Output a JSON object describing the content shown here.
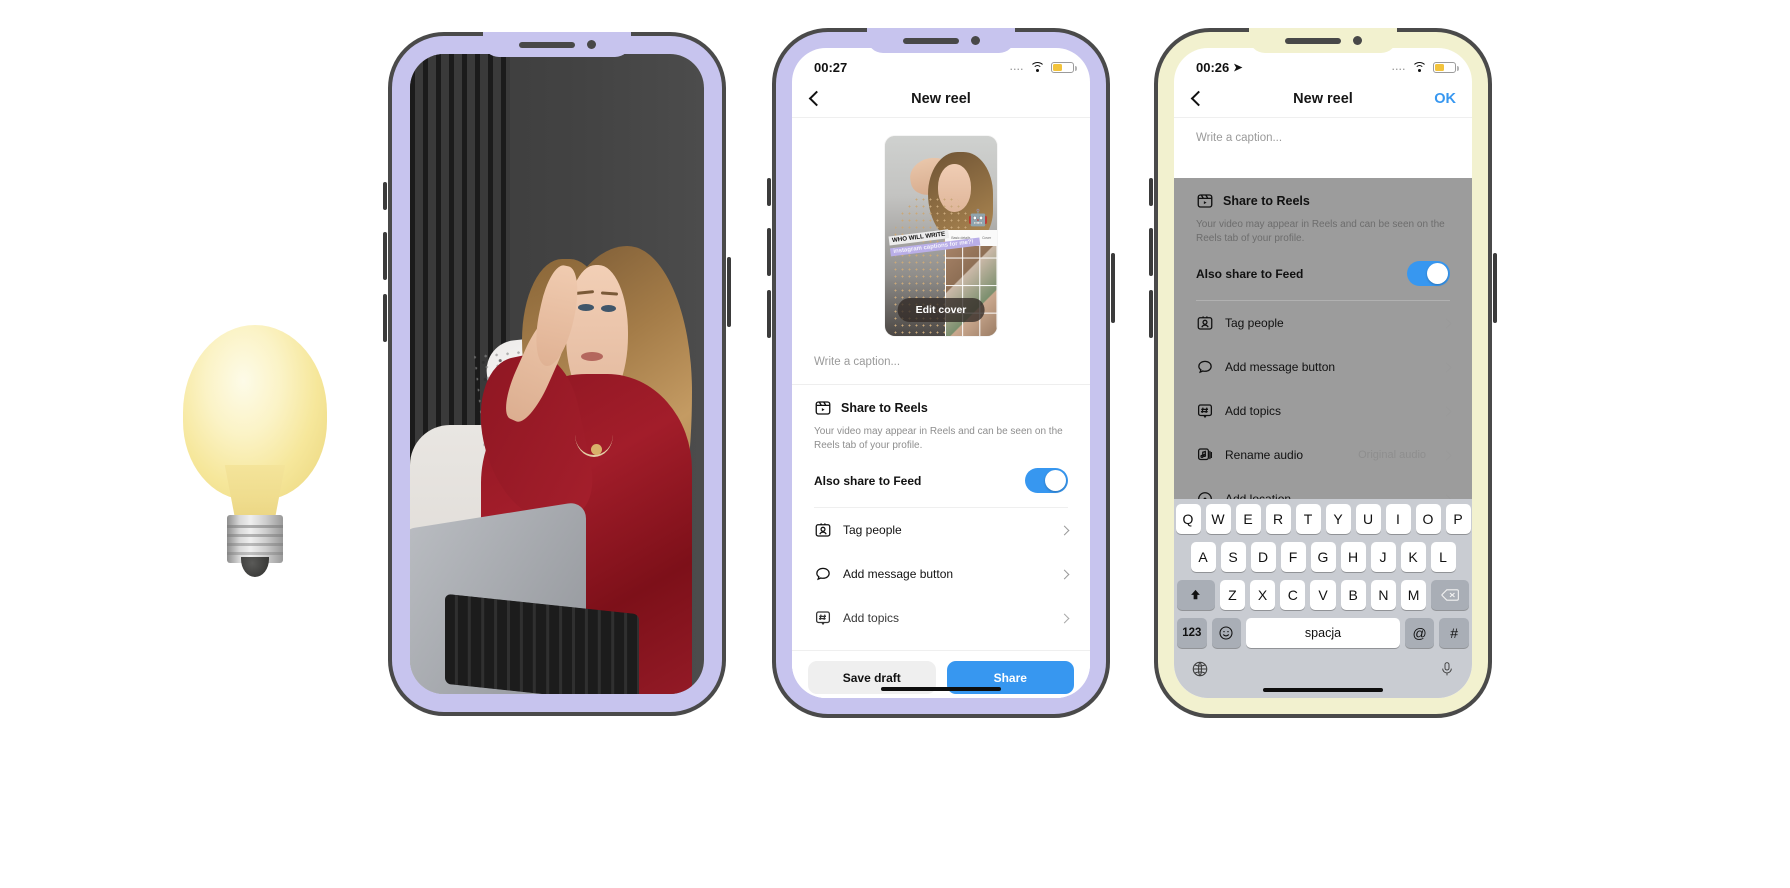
{
  "scene": {
    "bulb_icon": "light-bulb-icon"
  },
  "phone1": {
    "frame_color": "#c7c4ee",
    "content_description": "photo-of-woman-in-red-dress-with-laptop"
  },
  "phone2": {
    "frame_color": "#c7c4ee",
    "status": {
      "time": "00:27",
      "wifi_icon": "wifi-icon",
      "battery_icon": "battery-icon",
      "signal_dots": "...."
    },
    "nav": {
      "back_icon": "chevron-left-icon",
      "title": "New reel"
    },
    "thumbnail": {
      "edit_cover_label": "Edit cover",
      "overlay_line1": "WHO WILL WRITE",
      "overlay_line2": "instagram captions for me?!",
      "robot_icon": "robot-icon",
      "grid_tab1": "Basic details",
      "grid_tab2": "Cover"
    },
    "caption": {
      "placeholder": "Write a caption..."
    },
    "share_section": {
      "icon": "reels-icon",
      "title": "Share to Reels",
      "description": "Your video may appear in Reels and can be seen on the Reels tab of your profile.",
      "toggle_label": "Also share to Feed",
      "toggle_on": true,
      "accent_color": "#3797f0"
    },
    "menu": [
      {
        "icon": "tag-people-icon",
        "label": "Tag people",
        "value": "",
        "chevron": "chevron-right-icon"
      },
      {
        "icon": "message-bubble-icon",
        "label": "Add message button",
        "value": "",
        "chevron": "chevron-right-icon"
      },
      {
        "icon": "hashtag-icon",
        "label": "Add topics",
        "value": "",
        "chevron": "chevron-right-icon"
      }
    ],
    "footer": {
      "save_draft_label": "Save draft",
      "share_label": "Share"
    }
  },
  "phone3": {
    "frame_color": "#f2f1cf",
    "status": {
      "time": "00:26",
      "location_icon": "location-arrow-icon",
      "wifi_icon": "wifi-icon",
      "battery_icon": "battery-icon",
      "signal_dots": "...."
    },
    "nav": {
      "back_icon": "chevron-left-icon",
      "title": "New reel",
      "ok_label": "OK",
      "ok_color": "#3797f0"
    },
    "caption": {
      "placeholder": "Write a caption..."
    },
    "share_section": {
      "icon": "reels-icon",
      "title": "Share to Reels",
      "description": "Your video may appear in Reels and can be seen on the Reels tab of your profile.",
      "toggle_label": "Also share to Feed",
      "toggle_on": true
    },
    "menu": [
      {
        "icon": "tag-people-icon",
        "label": "Tag people",
        "value": "",
        "chevron": "chevron-right-icon"
      },
      {
        "icon": "message-bubble-icon",
        "label": "Add message button",
        "value": "",
        "chevron": "chevron-right-icon"
      },
      {
        "icon": "hashtag-icon",
        "label": "Add topics",
        "value": "",
        "chevron": "chevron-right-icon"
      },
      {
        "icon": "audio-note-icon",
        "label": "Rename audio",
        "value": "Original audio",
        "chevron": "chevron-right-icon"
      },
      {
        "icon": "location-pin-icon",
        "label": "Add location",
        "value": "",
        "chevron": "chevron-right-icon"
      }
    ],
    "keyboard": {
      "row1": [
        "Q",
        "W",
        "E",
        "R",
        "T",
        "Y",
        "U",
        "I",
        "O",
        "P"
      ],
      "row2": [
        "A",
        "S",
        "D",
        "F",
        "G",
        "H",
        "J",
        "K",
        "L"
      ],
      "row3_shift": "shift-icon",
      "row3": [
        "Z",
        "X",
        "C",
        "V",
        "B",
        "N",
        "M"
      ],
      "row3_backspace": "backspace-icon",
      "numbers_key": "123",
      "emoji_key": "emoji-icon",
      "space_key": "spacja",
      "at_key": "@",
      "hash_key": "#",
      "globe_key": "globe-icon",
      "mic_key": "microphone-icon"
    }
  }
}
